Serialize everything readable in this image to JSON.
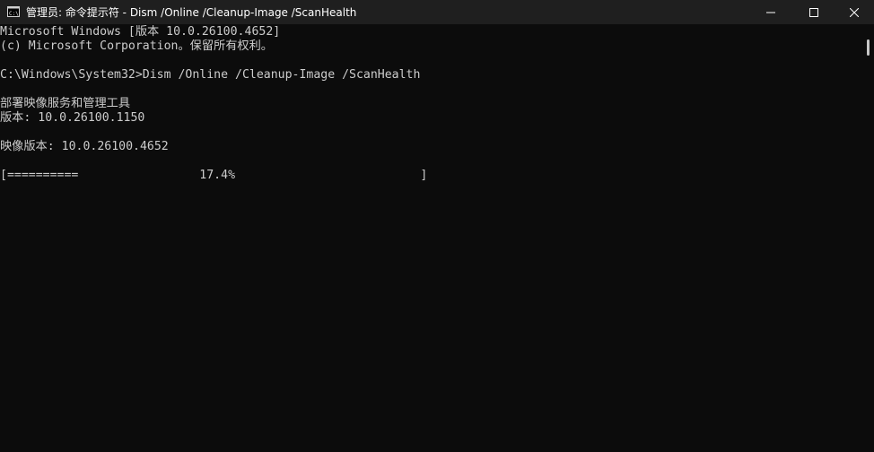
{
  "window": {
    "title": "管理员: 命令提示符 - Dism  /Online /Cleanup-Image /ScanHealth",
    "icon": "cmd-icon",
    "controls": {
      "minimize": "minimize-icon",
      "maximize": "maximize-icon",
      "close": "close-icon"
    }
  },
  "console": {
    "lines": [
      "Microsoft Windows [版本 10.0.26100.4652]",
      "(c) Microsoft Corporation。保留所有权利。",
      "",
      "C:\\Windows\\System32>Dism /Online /Cleanup-Image /ScanHealth",
      "",
      "部署映像服务和管理工具",
      "版本: 10.0.26100.1150",
      "",
      "映像版本: 10.0.26100.4652",
      "",
      "[==========                 17.4%                          ]"
    ],
    "progress_percent": 17.4,
    "text_color": "#cccccc",
    "background_color": "#0c0c0c"
  }
}
